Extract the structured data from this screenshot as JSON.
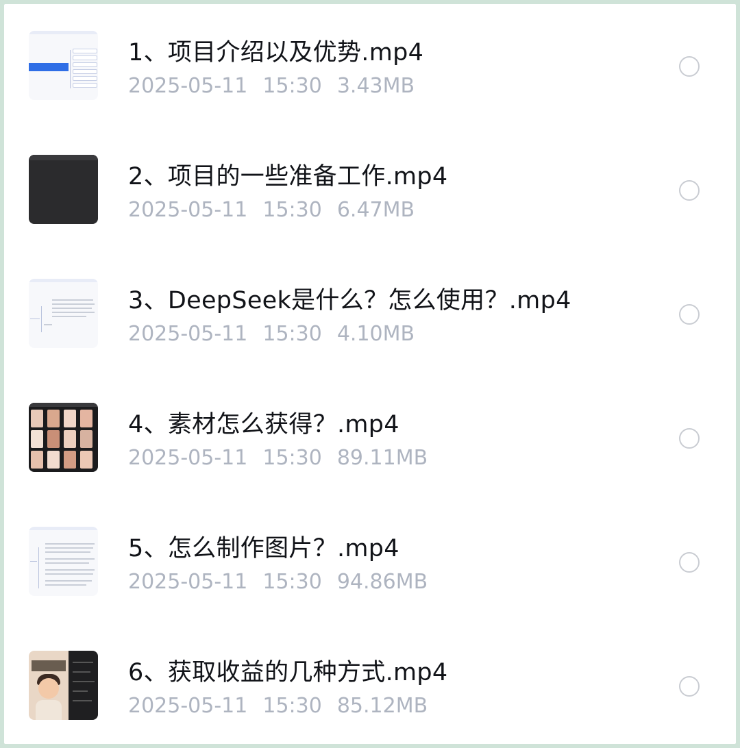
{
  "files": [
    {
      "title": "1、项目介绍以及优势.mp4",
      "date": "2025-05-11",
      "time": "15:30",
      "size": "3.43MB",
      "thumbnail": "mindmap-blue"
    },
    {
      "title": "2、项目的一些准备工作.mp4",
      "date": "2025-05-11",
      "time": "15:30",
      "size": "6.47MB",
      "thumbnail": "dark-screen"
    },
    {
      "title": "3、DeepSeek是什么？怎么使用？.mp4",
      "date": "2025-05-11",
      "time": "15:30",
      "size": "4.10MB",
      "thumbnail": "mindmap-text"
    },
    {
      "title": "4、素材怎么获得？.mp4",
      "date": "2025-05-11",
      "time": "15:30",
      "size": "89.11MB",
      "thumbnail": "image-grid"
    },
    {
      "title": "5、怎么制作图片？.mp4",
      "date": "2025-05-11",
      "time": "15:30",
      "size": "94.86MB",
      "thumbnail": "mindmap-text"
    },
    {
      "title": "6、获取收益的几种方式.mp4",
      "date": "2025-05-11",
      "time": "15:30",
      "size": "85.12MB",
      "thumbnail": "poster-chat"
    }
  ],
  "colors": {
    "background": "#cfe3d8",
    "card": "#ffffff",
    "title": "#111318",
    "meta": "#aeb4c0",
    "radio_border": "#c9ccd2"
  }
}
